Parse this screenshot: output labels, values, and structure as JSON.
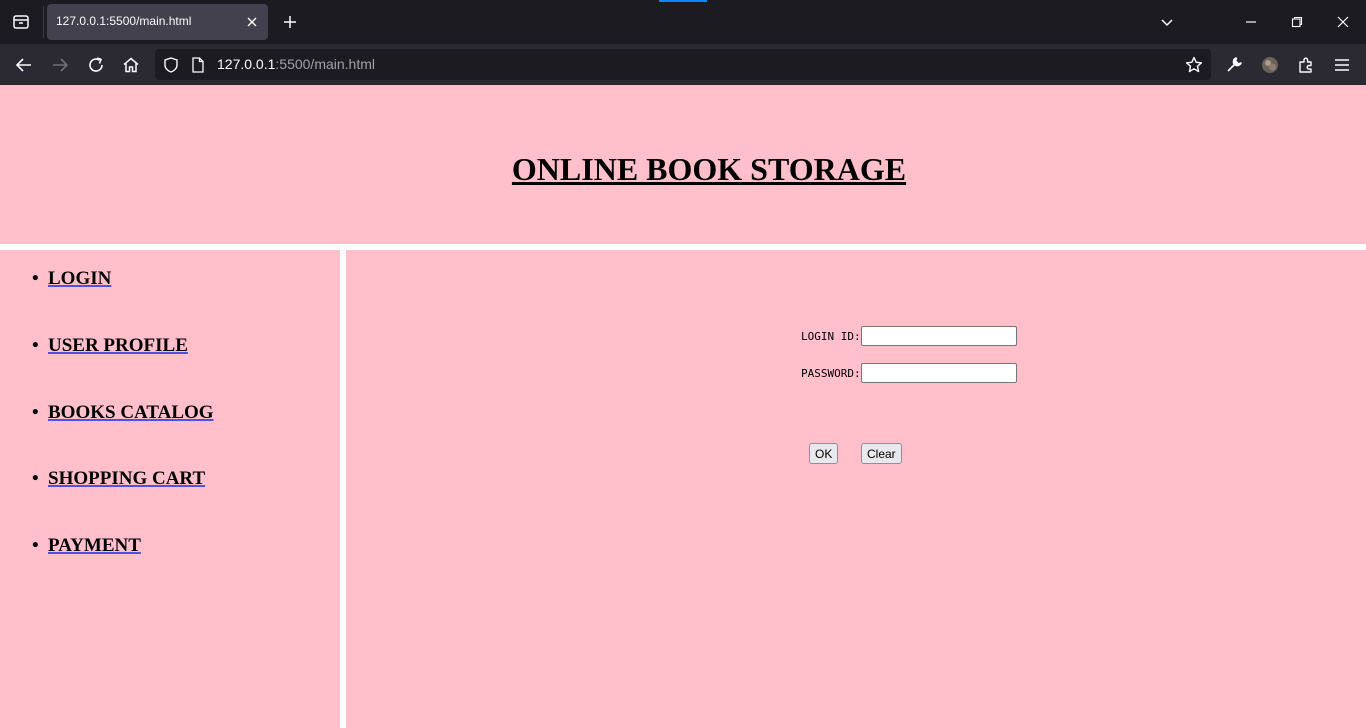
{
  "browser": {
    "tab_title": "127.0.0.1:5500/main.html",
    "url_host": "127.0.0.1",
    "url_path": ":5500/main.html",
    "colors": {
      "tabbar": "#1c1b22",
      "navbar": "#2b2a33",
      "active_tab": "#42414d"
    }
  },
  "page": {
    "title": "ONLINE BOOK STORAGE",
    "background": "#ffc0cb",
    "menu": [
      {
        "label": "LOGIN"
      },
      {
        "label": "USER PROFILE"
      },
      {
        "label": "BOOKS CATALOG"
      },
      {
        "label": "SHOPPING CART"
      },
      {
        "label": "PAYMENT"
      }
    ],
    "form": {
      "login_label": "LOGIN ID:",
      "login_value": "",
      "password_label": "PASSWORD:",
      "password_value": "",
      "ok_label": "OK",
      "clear_label": "Clear"
    }
  }
}
